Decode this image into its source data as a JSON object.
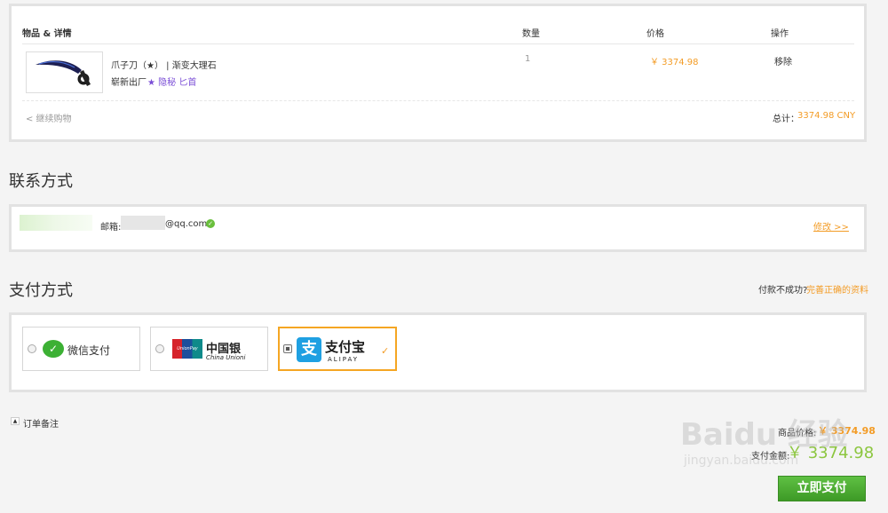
{
  "cart": {
    "headers": {
      "item": "物品 & 详情",
      "qty": "数量",
      "price": "价格",
      "action": "操作"
    },
    "item": {
      "name": "爪子刀（★） | 渐变大理石",
      "condition": "崭新出厂",
      "tags": "★ 隐秘 匕首",
      "qty": "1",
      "price": "￥ 3374.98",
      "remove": "移除"
    },
    "continue": "< 继续购物",
    "total_label": "总计：",
    "total_value": "3374.98 CNY"
  },
  "contact": {
    "title": "联系方式",
    "email_label": "邮箱:",
    "email_suffix": "@qq.com",
    "edit": "修改 >>"
  },
  "payment": {
    "title": "支付方式",
    "fail_prefix": "付款不成功?",
    "fail_link": "完善正确的资料",
    "wechat": "微信支付",
    "unionpay_cn": "中国银",
    "unionpay_en": "China Unioni",
    "unionpay_badge": "UnionPay",
    "alipay_cn": "支付宝",
    "alipay_en": "ALIPAY",
    "check": "✓"
  },
  "order": {
    "note": "订单备注",
    "goods_label": "商品价格:",
    "goods_value": "￥ 3374.98",
    "pay_label": "支付金额:",
    "pay_value": "￥ 3374.98",
    "submit": "立即支付"
  },
  "watermark": {
    "main": "Baidu 经验",
    "sub": "jingyan.baidu.com"
  }
}
